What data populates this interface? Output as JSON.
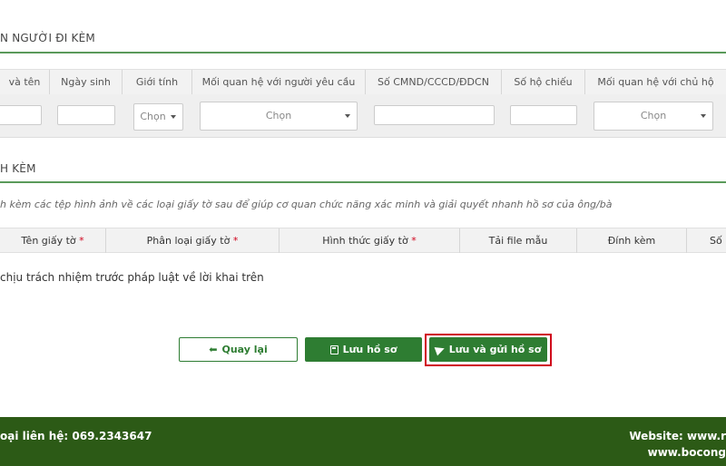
{
  "companions": {
    "section_title": "N NGƯỜI ĐI KÈM",
    "columns": [
      "và tên",
      "Ngày sinh",
      "Giới tính",
      "Mối quan hệ với người yêu cầu",
      "Số CMND/CCCD/ĐDCN",
      "Số hộ chiếu",
      "Mối quan hệ với chủ hộ"
    ],
    "gender_select": "Chọn",
    "relation_select": "Chọn",
    "owner_relation_select": "Chọn"
  },
  "attachments": {
    "section_title": "H KÈM",
    "note": "h kèm các tệp hình ảnh về các loại giấy tờ sau để giúp cơ quan chức năng xác minh và giải quyết nhanh hồ sơ của ông/bà",
    "columns": [
      "Tên giấy tờ",
      "Phân loại giấy tờ",
      "Hình thức giấy tờ",
      "Tải file mẫu",
      "Đính kèm",
      "Số"
    ],
    "required_mark": "*"
  },
  "declaration": "chịu trách nhiệm trước pháp luật về lời khai trên",
  "buttons": {
    "back": "Quay lại",
    "save": "Lưu hồ sơ",
    "save_submit": "Lưu và gửi hồ sơ"
  },
  "footer": {
    "phone": "oại liên hệ: 069.2343647",
    "website_line1": "Website: www.r",
    "website_line2": "www.bocong"
  },
  "colors": {
    "accent_green": "#2e7d32",
    "footer_green": "#2c5a16",
    "highlight_red": "#d0021b"
  }
}
